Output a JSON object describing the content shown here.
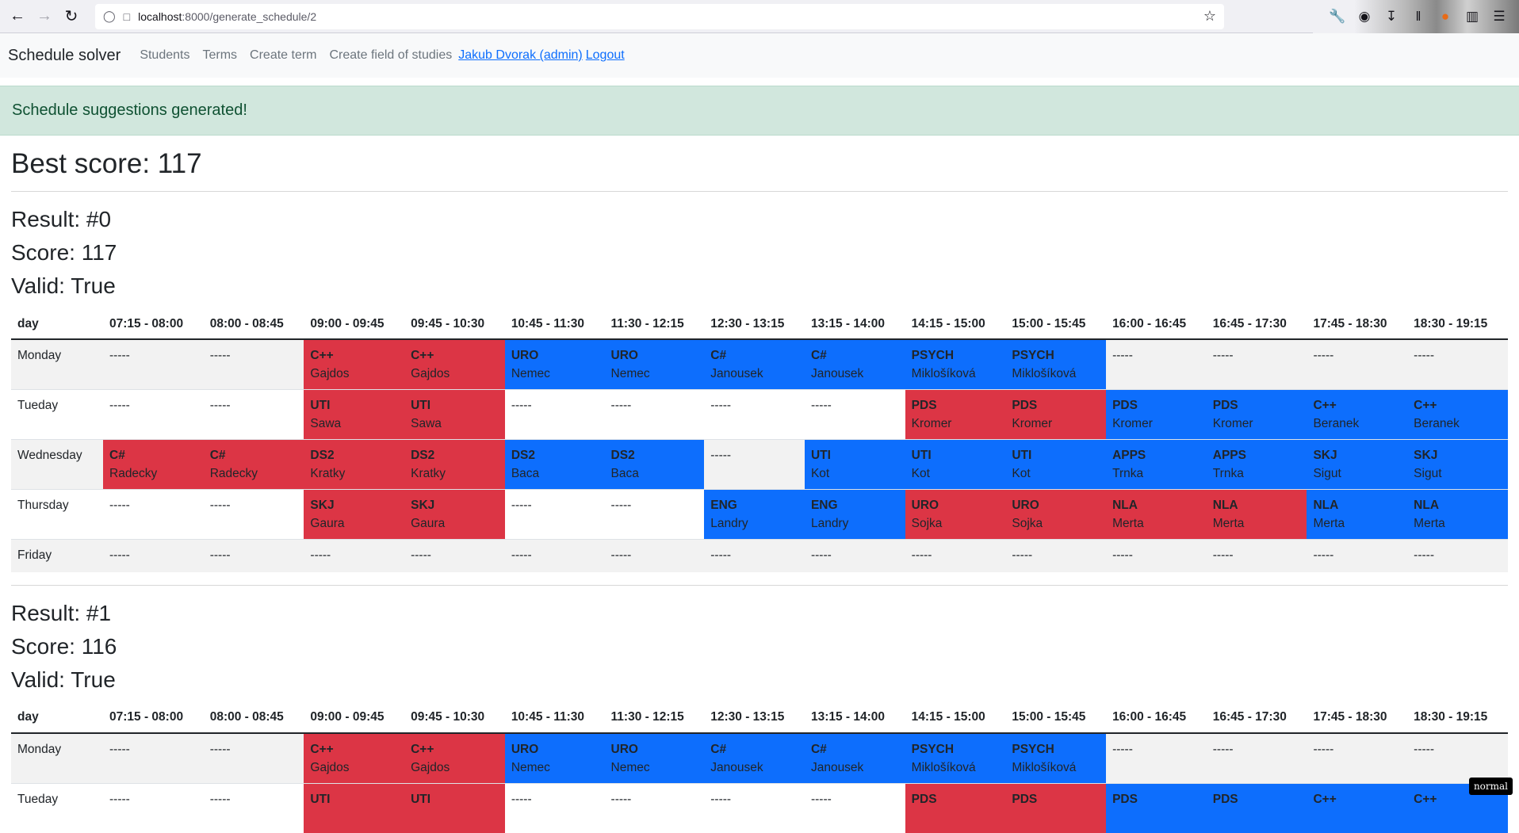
{
  "browser": {
    "url_host": "localhost",
    "url_path": ":8000/generate_schedule/2",
    "icons": [
      "back-arrow-icon",
      "forward-arrow-icon",
      "reload-icon",
      "shield-icon",
      "page-icon",
      "star-icon",
      "wrench-icon",
      "pocket-icon",
      "download-icon",
      "library-icon",
      "extension-icon",
      "basket-icon",
      "menu-icon"
    ]
  },
  "navbar": {
    "brand": "Schedule solver",
    "links": [
      "Students",
      "Terms",
      "Create term",
      "Create field of studies"
    ],
    "user": "Jakub Dvorak (admin)",
    "logout": "Logout"
  },
  "alert": "Schedule suggestions generated!",
  "best_score": "Best score: 117",
  "headers": [
    "day",
    "07:15 - 08:00",
    "08:00 - 08:45",
    "09:00 - 09:45",
    "09:45 - 10:30",
    "10:45 - 11:30",
    "11:30 - 12:15",
    "12:30 - 13:15",
    "13:15 - 14:00",
    "14:15 - 15:00",
    "15:00 - 15:45",
    "16:00 - 16:45",
    "16:45 - 17:30",
    "17:45 - 18:30",
    "18:30 - 19:15"
  ],
  "results": [
    {
      "result": "Result: #0",
      "score": "Score: 117",
      "valid": "Valid: True",
      "rows": [
        {
          "day": "Monday",
          "cells": [
            {
              "t": "-----"
            },
            {
              "t": "-----"
            },
            {
              "s": "C++",
              "p": "Gajdos",
              "c": "red"
            },
            {
              "s": "C++",
              "p": "Gajdos",
              "c": "red"
            },
            {
              "s": "URO",
              "p": "Nemec",
              "c": "blue"
            },
            {
              "s": "URO",
              "p": "Nemec",
              "c": "blue"
            },
            {
              "s": "C#",
              "p": "Janousek",
              "c": "blue"
            },
            {
              "s": "C#",
              "p": "Janousek",
              "c": "blue"
            },
            {
              "s": "PSYCH",
              "p": "Miklošíková",
              "c": "blue"
            },
            {
              "s": "PSYCH",
              "p": "Miklošíková",
              "c": "blue"
            },
            {
              "t": "-----"
            },
            {
              "t": "-----"
            },
            {
              "t": "-----"
            },
            {
              "t": "-----"
            }
          ]
        },
        {
          "day": "Tueday",
          "cells": [
            {
              "t": "-----"
            },
            {
              "t": "-----"
            },
            {
              "s": "UTI",
              "p": "Sawa",
              "c": "red"
            },
            {
              "s": "UTI",
              "p": "Sawa",
              "c": "red"
            },
            {
              "t": "-----"
            },
            {
              "t": "-----"
            },
            {
              "t": "-----"
            },
            {
              "t": "-----"
            },
            {
              "s": "PDS",
              "p": "Kromer",
              "c": "red"
            },
            {
              "s": "PDS",
              "p": "Kromer",
              "c": "red"
            },
            {
              "s": "PDS",
              "p": "Kromer",
              "c": "blue"
            },
            {
              "s": "PDS",
              "p": "Kromer",
              "c": "blue"
            },
            {
              "s": "C++",
              "p": "Beranek",
              "c": "blue"
            },
            {
              "s": "C++",
              "p": "Beranek",
              "c": "blue"
            }
          ]
        },
        {
          "day": "Wednesday",
          "cells": [
            {
              "s": "C#",
              "p": "Radecky",
              "c": "red"
            },
            {
              "s": "C#",
              "p": "Radecky",
              "c": "red"
            },
            {
              "s": "DS2",
              "p": "Kratky",
              "c": "red"
            },
            {
              "s": "DS2",
              "p": "Kratky",
              "c": "red"
            },
            {
              "s": "DS2",
              "p": "Baca",
              "c": "blue"
            },
            {
              "s": "DS2",
              "p": "Baca",
              "c": "blue"
            },
            {
              "t": "-----"
            },
            {
              "s": "UTI",
              "p": "Kot",
              "c": "blue"
            },
            {
              "s": "UTI",
              "p": "Kot",
              "c": "blue"
            },
            {
              "s": "UTI",
              "p": "Kot",
              "c": "blue"
            },
            {
              "s": "APPS",
              "p": "Trnka",
              "c": "blue"
            },
            {
              "s": "APPS",
              "p": "Trnka",
              "c": "blue"
            },
            {
              "s": "SKJ",
              "p": "Sigut",
              "c": "blue"
            },
            {
              "s": "SKJ",
              "p": "Sigut",
              "c": "blue"
            }
          ]
        },
        {
          "day": "Thursday",
          "cells": [
            {
              "t": "-----"
            },
            {
              "t": "-----"
            },
            {
              "s": "SKJ",
              "p": "Gaura",
              "c": "red"
            },
            {
              "s": "SKJ",
              "p": "Gaura",
              "c": "red"
            },
            {
              "t": "-----"
            },
            {
              "t": "-----"
            },
            {
              "s": "ENG",
              "p": "Landry",
              "c": "blue"
            },
            {
              "s": "ENG",
              "p": "Landry",
              "c": "blue"
            },
            {
              "s": "URO",
              "p": "Sojka",
              "c": "red"
            },
            {
              "s": "URO",
              "p": "Sojka",
              "c": "red"
            },
            {
              "s": "NLA",
              "p": "Merta",
              "c": "red"
            },
            {
              "s": "NLA",
              "p": "Merta",
              "c": "red"
            },
            {
              "s": "NLA",
              "p": "Merta",
              "c": "blue"
            },
            {
              "s": "NLA",
              "p": "Merta",
              "c": "blue"
            }
          ]
        },
        {
          "day": "Friday",
          "cells": [
            {
              "t": "-----"
            },
            {
              "t": "-----"
            },
            {
              "t": "-----"
            },
            {
              "t": "-----"
            },
            {
              "t": "-----"
            },
            {
              "t": "-----"
            },
            {
              "t": "-----"
            },
            {
              "t": "-----"
            },
            {
              "t": "-----"
            },
            {
              "t": "-----"
            },
            {
              "t": "-----"
            },
            {
              "t": "-----"
            },
            {
              "t": "-----"
            },
            {
              "t": "-----"
            }
          ]
        }
      ]
    },
    {
      "result": "Result: #1",
      "score": "Score: 116",
      "valid": "Valid: True",
      "rows": [
        {
          "day": "Monday",
          "cells": [
            {
              "t": "-----"
            },
            {
              "t": "-----"
            },
            {
              "s": "C++",
              "p": "Gajdos",
              "c": "red"
            },
            {
              "s": "C++",
              "p": "Gajdos",
              "c": "red"
            },
            {
              "s": "URO",
              "p": "Nemec",
              "c": "blue"
            },
            {
              "s": "URO",
              "p": "Nemec",
              "c": "blue"
            },
            {
              "s": "C#",
              "p": "Janousek",
              "c": "blue"
            },
            {
              "s": "C#",
              "p": "Janousek",
              "c": "blue"
            },
            {
              "s": "PSYCH",
              "p": "Miklošíková",
              "c": "blue"
            },
            {
              "s": "PSYCH",
              "p": "Miklošíková",
              "c": "blue"
            },
            {
              "t": "-----"
            },
            {
              "t": "-----"
            },
            {
              "t": "-----"
            },
            {
              "t": "-----"
            }
          ]
        },
        {
          "day": "Tueday",
          "cells": [
            {
              "t": "-----"
            },
            {
              "t": "-----"
            },
            {
              "s": "UTI",
              "p": "",
              "c": "red"
            },
            {
              "s": "UTI",
              "p": "",
              "c": "red"
            },
            {
              "t": "-----"
            },
            {
              "t": "-----"
            },
            {
              "t": "-----"
            },
            {
              "t": "-----"
            },
            {
              "s": "PDS",
              "p": "",
              "c": "red"
            },
            {
              "s": "PDS",
              "p": "",
              "c": "red"
            },
            {
              "s": "PDS",
              "p": "",
              "c": "blue"
            },
            {
              "s": "PDS",
              "p": "",
              "c": "blue"
            },
            {
              "s": "C++",
              "p": "",
              "c": "blue"
            },
            {
              "s": "C++",
              "p": "",
              "c": "blue"
            }
          ]
        }
      ]
    }
  ],
  "mode_badge": "normal",
  "colors": {
    "red": "#dc3545",
    "blue": "#0d6efd",
    "alert_bg": "#d1e7dd",
    "alert_text": "#0f5132"
  }
}
